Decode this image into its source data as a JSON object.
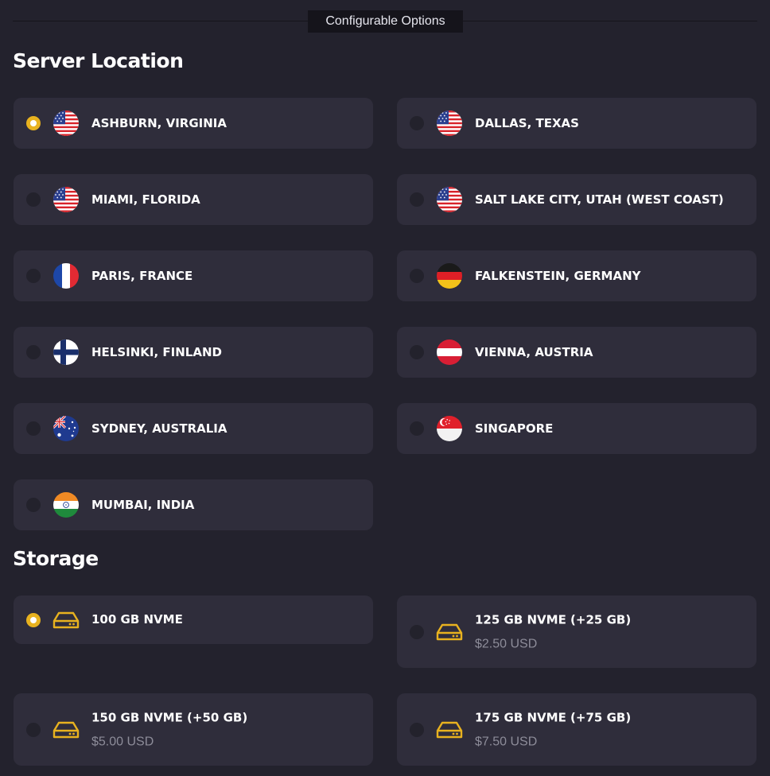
{
  "header": {
    "divider_label": "Configurable Options"
  },
  "server_location": {
    "title": "Server Location",
    "options": [
      {
        "label": "ASHBURN, VIRGINIA",
        "flag": "us-flag-icon",
        "selected": true
      },
      {
        "label": "DALLAS, TEXAS",
        "flag": "us-flag-icon",
        "selected": false
      },
      {
        "label": "MIAMI, FLORIDA",
        "flag": "us-flag-icon",
        "selected": false
      },
      {
        "label": "SALT LAKE CITY, UTAH (WEST COAST)",
        "flag": "us-flag-icon",
        "selected": false
      },
      {
        "label": "PARIS, FRANCE",
        "flag": "france-flag-icon",
        "selected": false
      },
      {
        "label": "FALKENSTEIN, GERMANY",
        "flag": "germany-flag-icon",
        "selected": false
      },
      {
        "label": "HELSINKI, FINLAND",
        "flag": "finland-flag-icon",
        "selected": false
      },
      {
        "label": "VIENNA, AUSTRIA",
        "flag": "austria-flag-icon",
        "selected": false
      },
      {
        "label": "SYDNEY, AUSTRALIA",
        "flag": "australia-flag-icon",
        "selected": false
      },
      {
        "label": "SINGAPORE",
        "flag": "singapore-flag-icon",
        "selected": false
      },
      {
        "label": "MUMBAI, INDIA",
        "flag": "india-flag-icon",
        "selected": false
      }
    ]
  },
  "storage": {
    "title": "Storage",
    "options": [
      {
        "label": "100 GB NVME",
        "price": "",
        "selected": true
      },
      {
        "label": "125 GB NVME (+25 GB)",
        "price": "$2.50 USD",
        "selected": false
      },
      {
        "label": "150 GB NVME (+50 GB)",
        "price": "$5.00 USD",
        "selected": false
      },
      {
        "label": "175 GB NVME (+75 GB)",
        "price": "$7.50 USD",
        "selected": false
      }
    ]
  },
  "colors": {
    "background": "#23222d",
    "card": "#2f2d3b",
    "accent": "#e8b21f",
    "muted_text": "#8d8c99"
  }
}
